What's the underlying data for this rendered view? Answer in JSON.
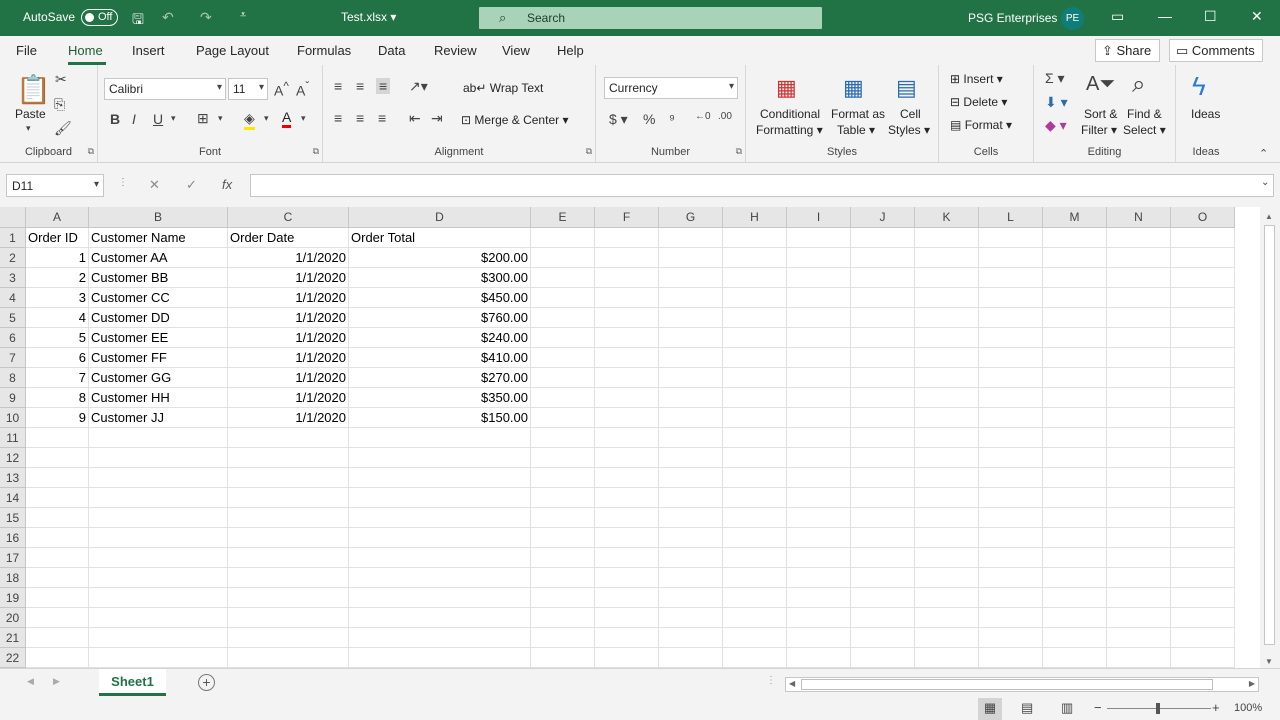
{
  "titlebar": {
    "autosave_label": "AutoSave",
    "autosave_state": "Off",
    "filename": "Test.xlsx",
    "search_placeholder": "Search",
    "org": "PSG Enterprises",
    "avatar_initials": "PE"
  },
  "tabs": [
    "File",
    "Home",
    "Insert",
    "Page Layout",
    "Formulas",
    "Data",
    "Review",
    "View",
    "Help"
  ],
  "active_tab": "Home",
  "share_label": "Share",
  "comments_label": "Comments",
  "ribbon": {
    "clipboard": {
      "label": "Clipboard",
      "paste": "Paste"
    },
    "font": {
      "label": "Font",
      "font_name": "Calibri",
      "font_size": "11"
    },
    "alignment": {
      "label": "Alignment",
      "wrap": "Wrap Text",
      "merge": "Merge & Center"
    },
    "number": {
      "label": "Number",
      "format": "Currency"
    },
    "styles": {
      "label": "Styles",
      "conditional_1": "Conditional",
      "conditional_2": "Formatting",
      "format_table_1": "Format as",
      "format_table_2": "Table",
      "cell_styles_1": "Cell",
      "cell_styles_2": "Styles"
    },
    "cells": {
      "label": "Cells",
      "insert": "Insert",
      "delete": "Delete",
      "format": "Format"
    },
    "editing": {
      "label": "Editing",
      "sort_1": "Sort &",
      "sort_2": "Filter",
      "find_1": "Find &",
      "find_2": "Select"
    },
    "ideas": {
      "label": "Ideas",
      "button": "Ideas"
    }
  },
  "namebox": "D11",
  "formula": "",
  "columns": [
    "A",
    "B",
    "C",
    "D",
    "E",
    "F",
    "G",
    "H",
    "I",
    "J",
    "K",
    "L",
    "M",
    "N",
    "O"
  ],
  "rows": [
    "1",
    "2",
    "3",
    "4",
    "5",
    "6",
    "7",
    "8",
    "9",
    "10",
    "11",
    "12",
    "13",
    "14",
    "15",
    "16",
    "17",
    "18",
    "19",
    "20",
    "21",
    "22"
  ],
  "table": {
    "headers": [
      "Order ID",
      "Customer Name",
      "Order Date",
      "Order Total"
    ],
    "data": [
      [
        "1",
        "Customer AA",
        "1/1/2020",
        "$200.00"
      ],
      [
        "2",
        "Customer BB",
        "1/1/2020",
        "$300.00"
      ],
      [
        "3",
        "Customer CC",
        "1/1/2020",
        "$450.00"
      ],
      [
        "4",
        "Customer DD",
        "1/1/2020",
        "$760.00"
      ],
      [
        "5",
        "Customer EE",
        "1/1/2020",
        "$240.00"
      ],
      [
        "6",
        "Customer FF",
        "1/1/2020",
        "$410.00"
      ],
      [
        "7",
        "Customer GG",
        "1/1/2020",
        "$270.00"
      ],
      [
        "8",
        "Customer HH",
        "1/1/2020",
        "$350.00"
      ],
      [
        "9",
        "Customer JJ",
        "1/1/2020",
        "$150.00"
      ]
    ]
  },
  "sheet": "Sheet1",
  "zoom": "100%",
  "colors": {
    "brand": "#217346",
    "search_bg": "#a9d3b9"
  }
}
